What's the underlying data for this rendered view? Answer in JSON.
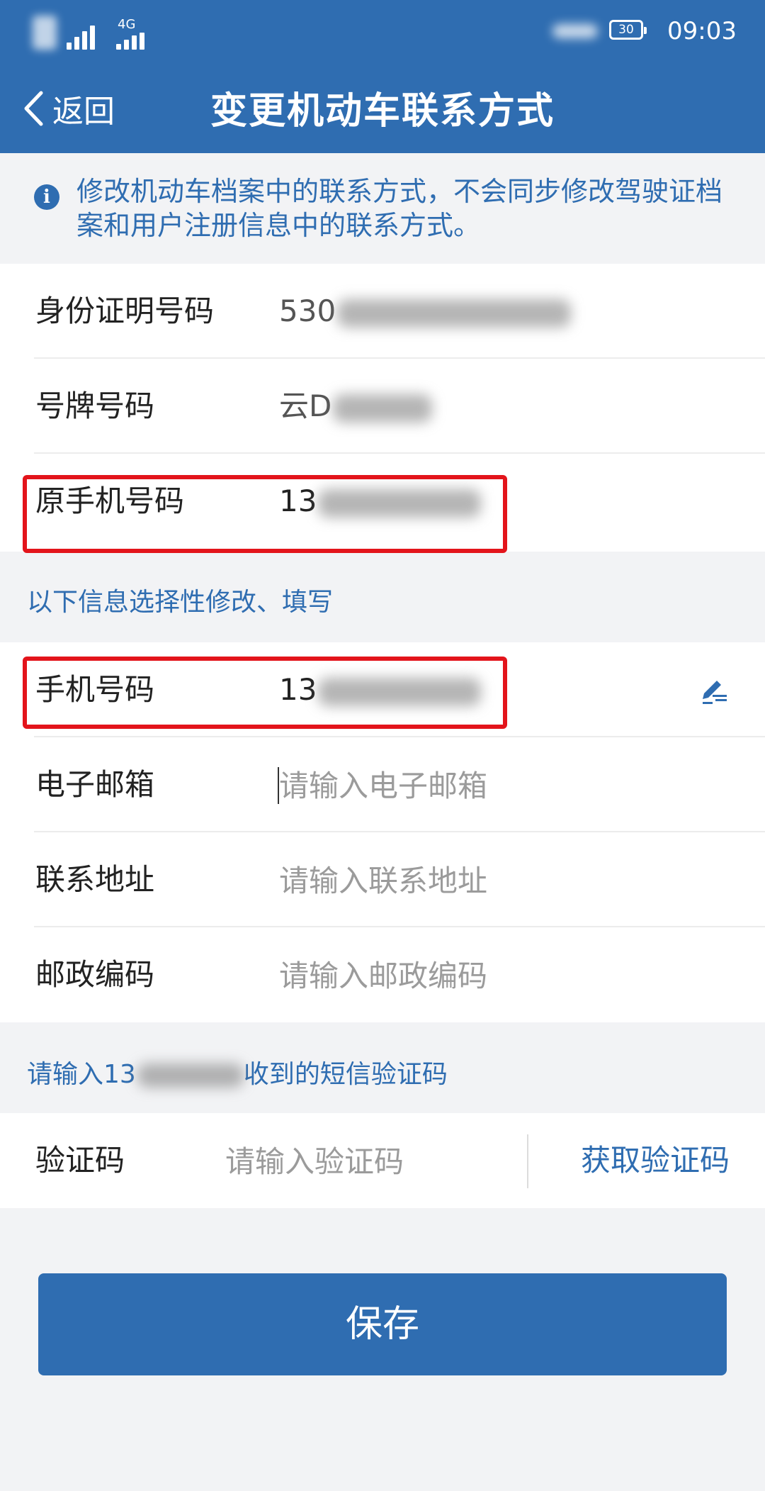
{
  "status_bar": {
    "network": "4G",
    "battery": "30",
    "time": "09:03"
  },
  "nav": {
    "back_label": "返回",
    "title": "变更机动车联系方式"
  },
  "notice": {
    "text": "修改机动车档案中的联系方式，不会同步修改驾驶证档案和用户注册信息中的联系方式。"
  },
  "vehicle_info": {
    "id_number": {
      "label": "身份证明号码",
      "value_visible": "530"
    },
    "plate_number": {
      "label": "号牌号码",
      "value_visible": "云D"
    },
    "original_phone": {
      "label": "原手机号码",
      "value_visible": "13"
    }
  },
  "optional_section": {
    "label": "以下信息选择性修改、填写",
    "phone": {
      "label": "手机号码",
      "value_visible": "13"
    },
    "email": {
      "label": "电子邮箱",
      "placeholder": "请输入电子邮箱"
    },
    "address": {
      "label": "联系地址",
      "placeholder": "请输入联系地址"
    },
    "postcode": {
      "label": "邮政编码",
      "placeholder": "请输入邮政编码"
    }
  },
  "sms": {
    "prompt_prefix": "请输入13",
    "prompt_suffix": "收到的短信验证码",
    "code_label": "验证码",
    "code_placeholder": "请输入验证码",
    "get_code_label": "获取验证码"
  },
  "save_label": "保存",
  "colors": {
    "brand_blue": "#2f6db1",
    "highlight_red": "#e3141b",
    "background": "#f2f3f5"
  }
}
